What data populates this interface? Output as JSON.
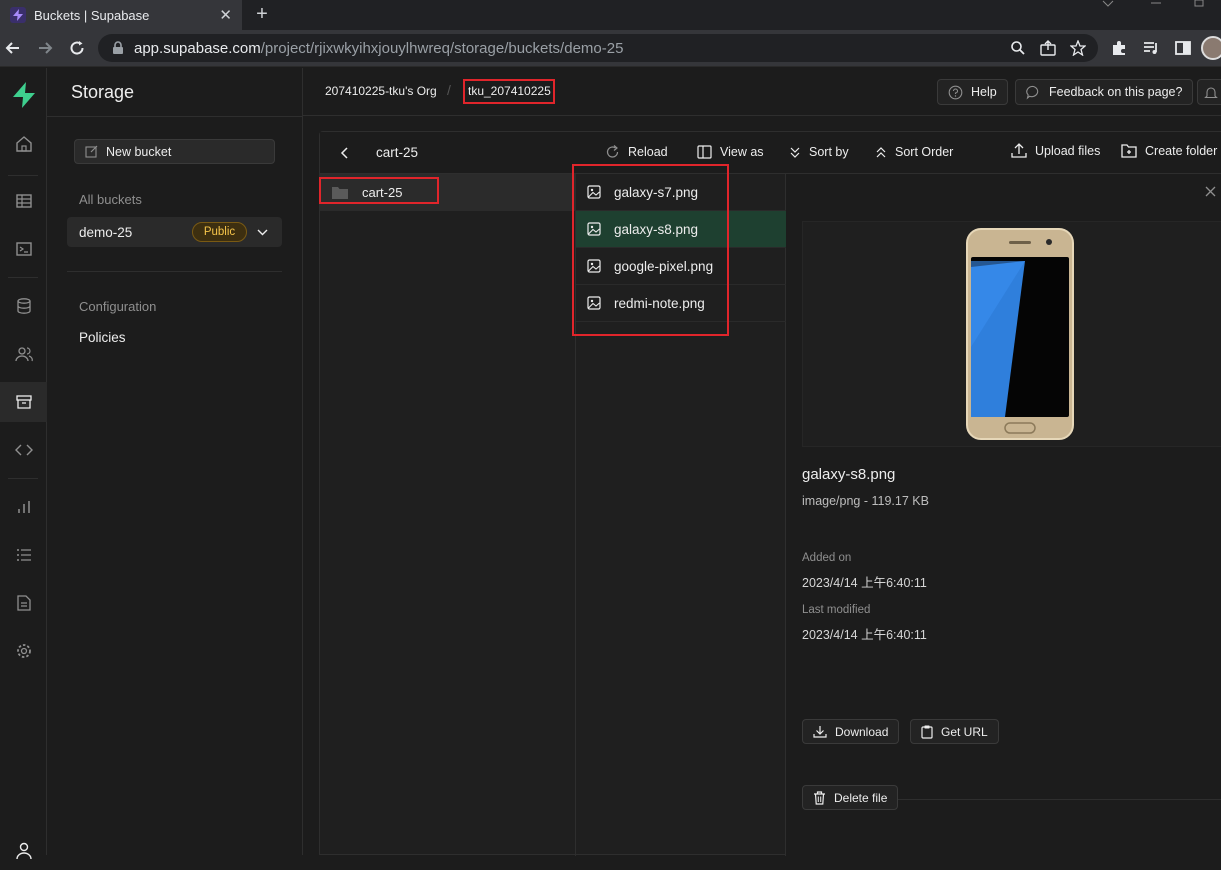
{
  "browser": {
    "tab_title": "Buckets | Supabase",
    "tab_close": "✕",
    "new_tab": "+",
    "url_host": "app.supabase.com",
    "url_path": "/project/rjixwkyihxjouylhwreq/storage/buckets/demo-25"
  },
  "header": {
    "org": "207410225-tku's Org",
    "separator": "/",
    "project": "tku_207410225",
    "help": "Help",
    "feedback": "Feedback on this page?"
  },
  "sidebar": {
    "title": "Storage",
    "new_bucket": "New bucket",
    "all_buckets_label": "All buckets",
    "bucket_name": "demo-25",
    "bucket_badge": "Public",
    "configuration_label": "Configuration",
    "policies": "Policies"
  },
  "explorer": {
    "current_folder": "cart-25",
    "toolbar": {
      "reload": "Reload",
      "view_as": "View as",
      "sort_by": "Sort by",
      "sort_order": "Sort Order",
      "upload": "Upload files",
      "create_folder": "Create folder"
    },
    "folders": [
      "cart-25"
    ],
    "files": [
      "galaxy-s7.png",
      "galaxy-s8.png",
      "google-pixel.png",
      "redmi-note.png"
    ],
    "selected_file": "galaxy-s8.png"
  },
  "preview": {
    "name": "galaxy-s8.png",
    "meta": "image/png - 119.17 KB",
    "added_label": "Added on",
    "added_value": "2023/4/14 上午6:40:11",
    "modified_label": "Last modified",
    "modified_value": "2023/4/14 上午6:40:11",
    "download": "Download",
    "get_url": "Get URL",
    "delete": "Delete file"
  },
  "colors": {
    "accent": "#3ecf8e",
    "selected_row": "#1e4030",
    "highlight": "#e0252b",
    "badge_text": "#f5c44a"
  }
}
